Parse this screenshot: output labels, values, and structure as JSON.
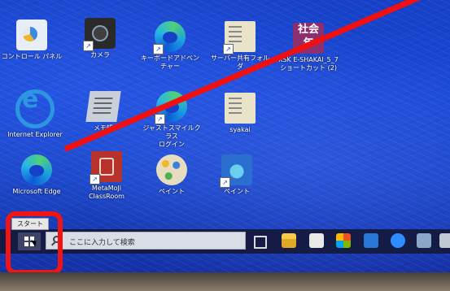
{
  "desktop": {
    "icons": [
      {
        "label": "コントロール パネル",
        "icon": "control-panel-icon"
      },
      {
        "label": "カメラ",
        "icon": "camera-icon"
      },
      {
        "label": "キーボードアドベンチャー",
        "icon": "edge-icon"
      },
      {
        "label": "サーバー共有フォルダ",
        "icon": "document-icon"
      },
      {
        "label": "KSK E-SHAKAI_5_7\nショートカット (2)",
        "icon": "shakai-icon",
        "badge_text": "社会\n年"
      },
      {
        "label": "Internet Explorer",
        "icon": "internet-explorer-icon"
      },
      {
        "label": "メモ帳",
        "icon": "notepad-icon"
      },
      {
        "label": "ジャストスマイルクラス\nログイン",
        "icon": "edge-icon"
      },
      {
        "label": "syakai",
        "icon": "document-icon"
      },
      {
        "label": "Microsoft Edge",
        "icon": "edge-icon"
      },
      {
        "label": "MetaMoJi\nClassRoom",
        "icon": "metamoji-icon"
      },
      {
        "label": "ペイント",
        "icon": "paint-icon"
      },
      {
        "label": "ペイント",
        "icon": "paint-3d-icon"
      }
    ]
  },
  "taskbar": {
    "start_tooltip": "スタート",
    "search_placeholder": "ここに入力して検索"
  },
  "annotation": {
    "color": "#f01414"
  }
}
